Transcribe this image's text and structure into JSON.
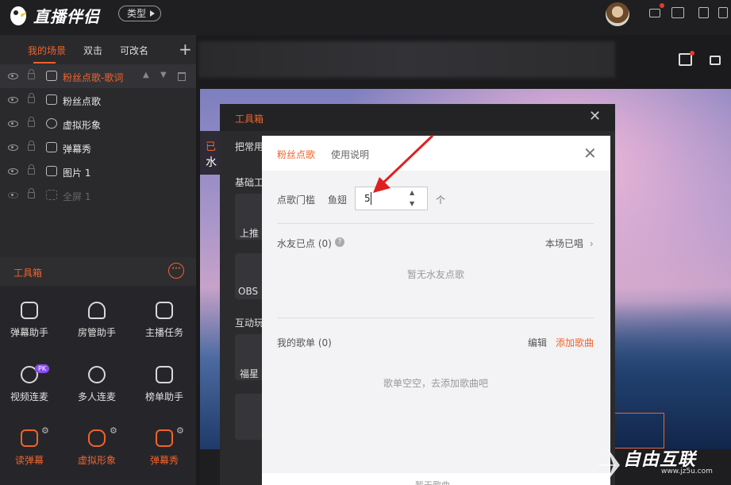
{
  "app": {
    "title": "直播伴侣",
    "type_button": "类型"
  },
  "left_tabs": [
    "我的场景",
    "双击",
    "可改名"
  ],
  "scenes": [
    {
      "label": "粉丝点歌-歌词",
      "selected": true,
      "icon": "puzzle-icon"
    },
    {
      "label": "粉丝点歌",
      "selected": false,
      "icon": "puzzle-icon"
    },
    {
      "label": "虚拟形象",
      "selected": false,
      "icon": "avatar-icon"
    },
    {
      "label": "弹幕秀",
      "selected": false,
      "icon": "tv-icon"
    },
    {
      "label": "图片 1",
      "selected": false,
      "icon": "image-icon"
    },
    {
      "label": "全屏 1",
      "selected": false,
      "icon": "fullscreen-icon",
      "disabled": true
    }
  ],
  "toolbox": {
    "title": "工具箱",
    "tools": [
      {
        "label": "弹幕助手",
        "icon": "chat-icon"
      },
      {
        "label": "房管助手",
        "icon": "admin-icon"
      },
      {
        "label": "主播任务",
        "icon": "puzzle-icon"
      },
      {
        "label": "视频连麦",
        "icon": "mic-icon",
        "badge": "PK"
      },
      {
        "label": "多人连麦",
        "icon": "multi-mic-icon"
      },
      {
        "label": "榜单助手",
        "icon": "puzzle-icon"
      },
      {
        "label": "读弹幕",
        "icon": "read-danmu-icon",
        "active": true
      },
      {
        "label": "虚拟形象",
        "icon": "avatar-icon",
        "active": true
      },
      {
        "label": "弹幕秀",
        "icon": "tv-icon",
        "active": true
      }
    ]
  },
  "canvas": {
    "strip_text_1": "已",
    "strip_text_2": "水"
  },
  "toolbox_dialog": {
    "title": "工具箱",
    "row1": "把常用",
    "section1": "基础工",
    "card1": "上推",
    "card2": "OBS",
    "section2": "互动玩",
    "card3": "福星"
  },
  "fan_dialog": {
    "tabs": [
      "粉丝点歌",
      "使用说明"
    ],
    "threshold_label": "点歌门槛",
    "threshold_item": "鱼翅",
    "threshold_value": "5",
    "threshold_unit": "个",
    "waterfriend_label": "水友已点 (0)",
    "waterfriend_help": "?",
    "waterfriend_link": "本场已唱",
    "waterfriend_empty": "暂无水友点歌",
    "songlist_label": "我的歌单 (0)",
    "songlist_edit": "编辑",
    "songlist_add": "添加歌曲",
    "songlist_empty": "歌单空空，去添加歌曲吧",
    "bottom_text": "暂无歌曲"
  },
  "watermark": {
    "text": "自由互联",
    "url": "www.jz5u.com"
  },
  "colors": {
    "accent": "#f0632b",
    "arrow": "#e02020",
    "pk_badge": "#8b4cf0"
  }
}
